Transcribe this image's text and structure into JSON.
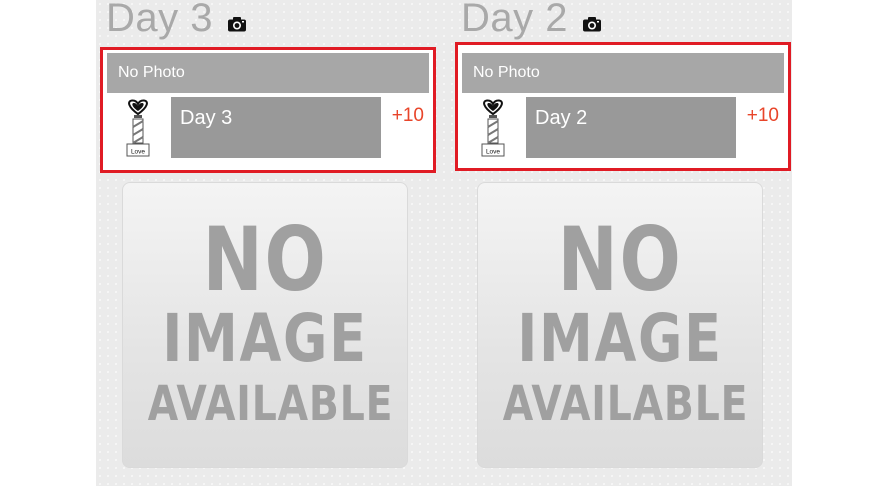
{
  "days": [
    {
      "title": "Day 3",
      "card": {
        "status": "No Photo",
        "name": "Day 3",
        "points": "+10",
        "avatar_caption": "Love"
      },
      "placeholder": {
        "line1": "NO",
        "line2": "IMAGE",
        "line3": "AVAILABLE"
      }
    },
    {
      "title": "Day 2",
      "card": {
        "status": "No Photo",
        "name": "Day 2",
        "points": "+10",
        "avatar_caption": "Love"
      },
      "placeholder": {
        "line1": "NO",
        "line2": "IMAGE",
        "line3": "AVAILABLE"
      }
    }
  ],
  "icons": {
    "camera": "camera-icon",
    "avatar": "love-trophy-icon"
  },
  "colors": {
    "highlight_border": "#e01b24",
    "points": "#e8452a",
    "status_bar": "#a7a7a7",
    "name_box": "#999999",
    "title": "#a9a9a9"
  }
}
